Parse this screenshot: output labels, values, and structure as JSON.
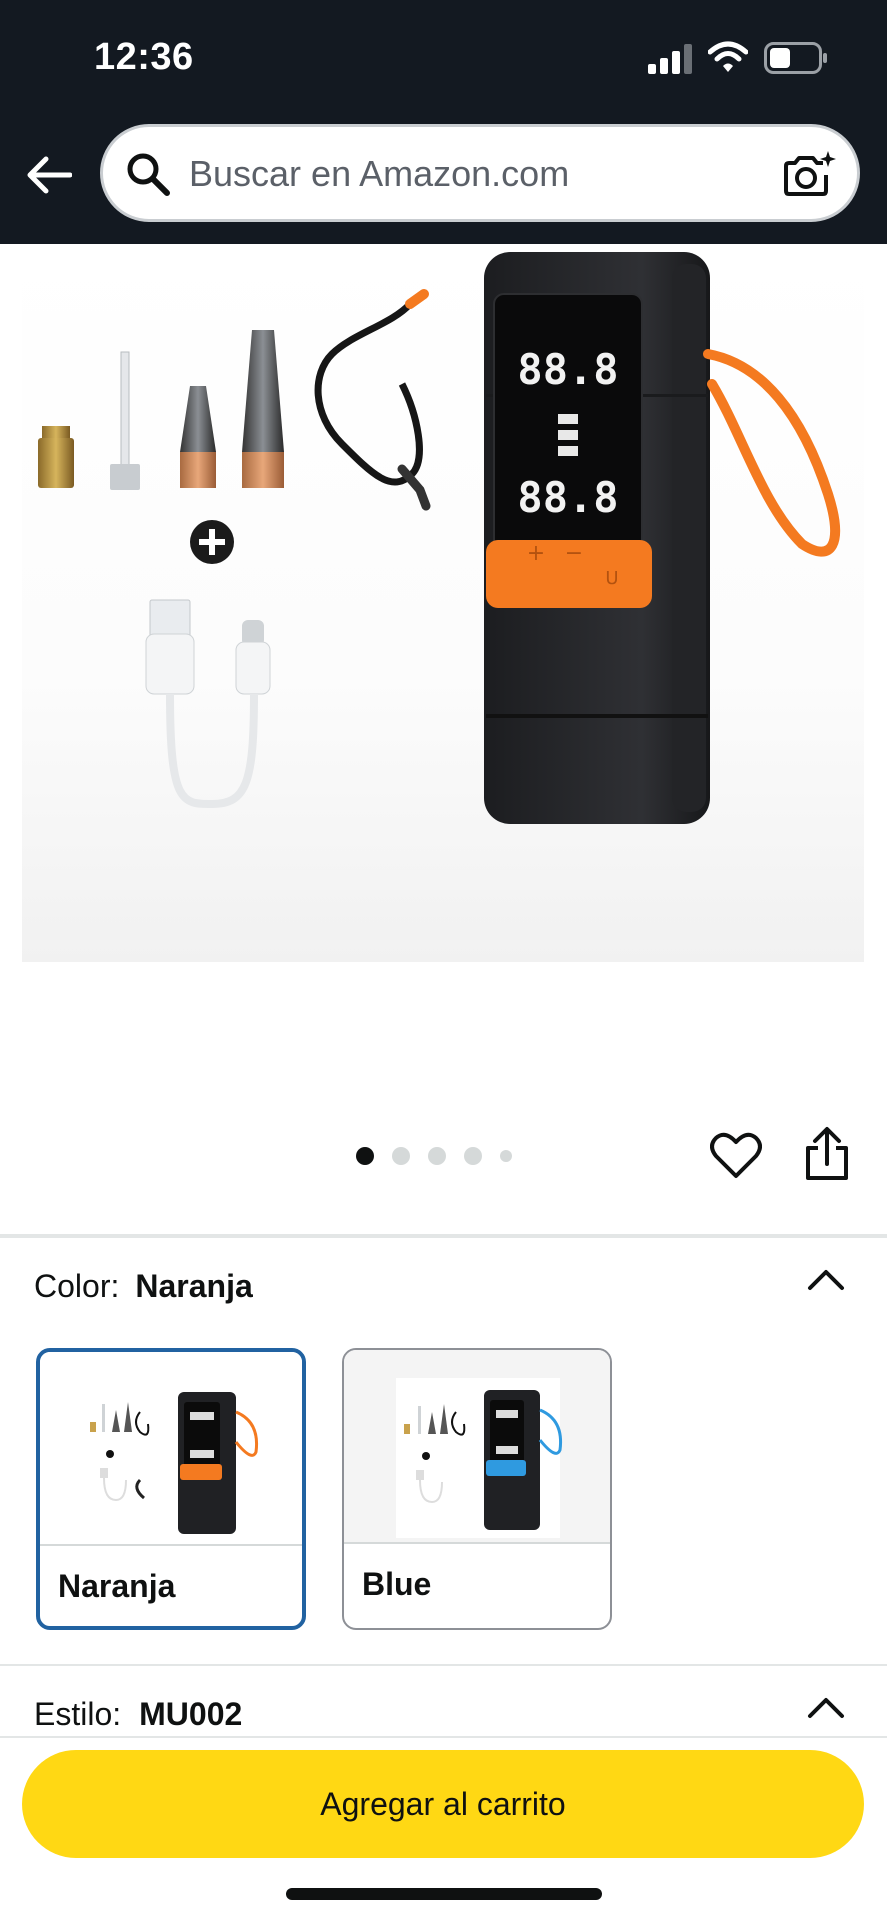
{
  "status_bar": {
    "time": "12:36"
  },
  "header": {
    "search_placeholder": "Buscar en Amazon.com"
  },
  "gallery": {
    "image_count": 5,
    "active_index": 0
  },
  "display": {
    "row1": "88.8",
    "row2": "88.8",
    "button_plus": "+",
    "button_minus": "−",
    "button_unit": "U"
  },
  "color": {
    "label": "Color:",
    "selected": "Naranja",
    "options": [
      {
        "label": "Naranja",
        "accent": "#f47a20",
        "selected": true
      },
      {
        "label": "Blue",
        "accent": "#2f9ae0",
        "selected": false
      }
    ]
  },
  "style": {
    "label": "Estilo:",
    "selected": "MU002"
  },
  "cart": {
    "button_label": "Agregar al carrito"
  },
  "colors": {
    "header_bg": "#131921",
    "cart_button": "#ffd814",
    "selected_border": "#2162a1",
    "device_orange": "#f47a20",
    "device_body": "#2a2b2e"
  }
}
